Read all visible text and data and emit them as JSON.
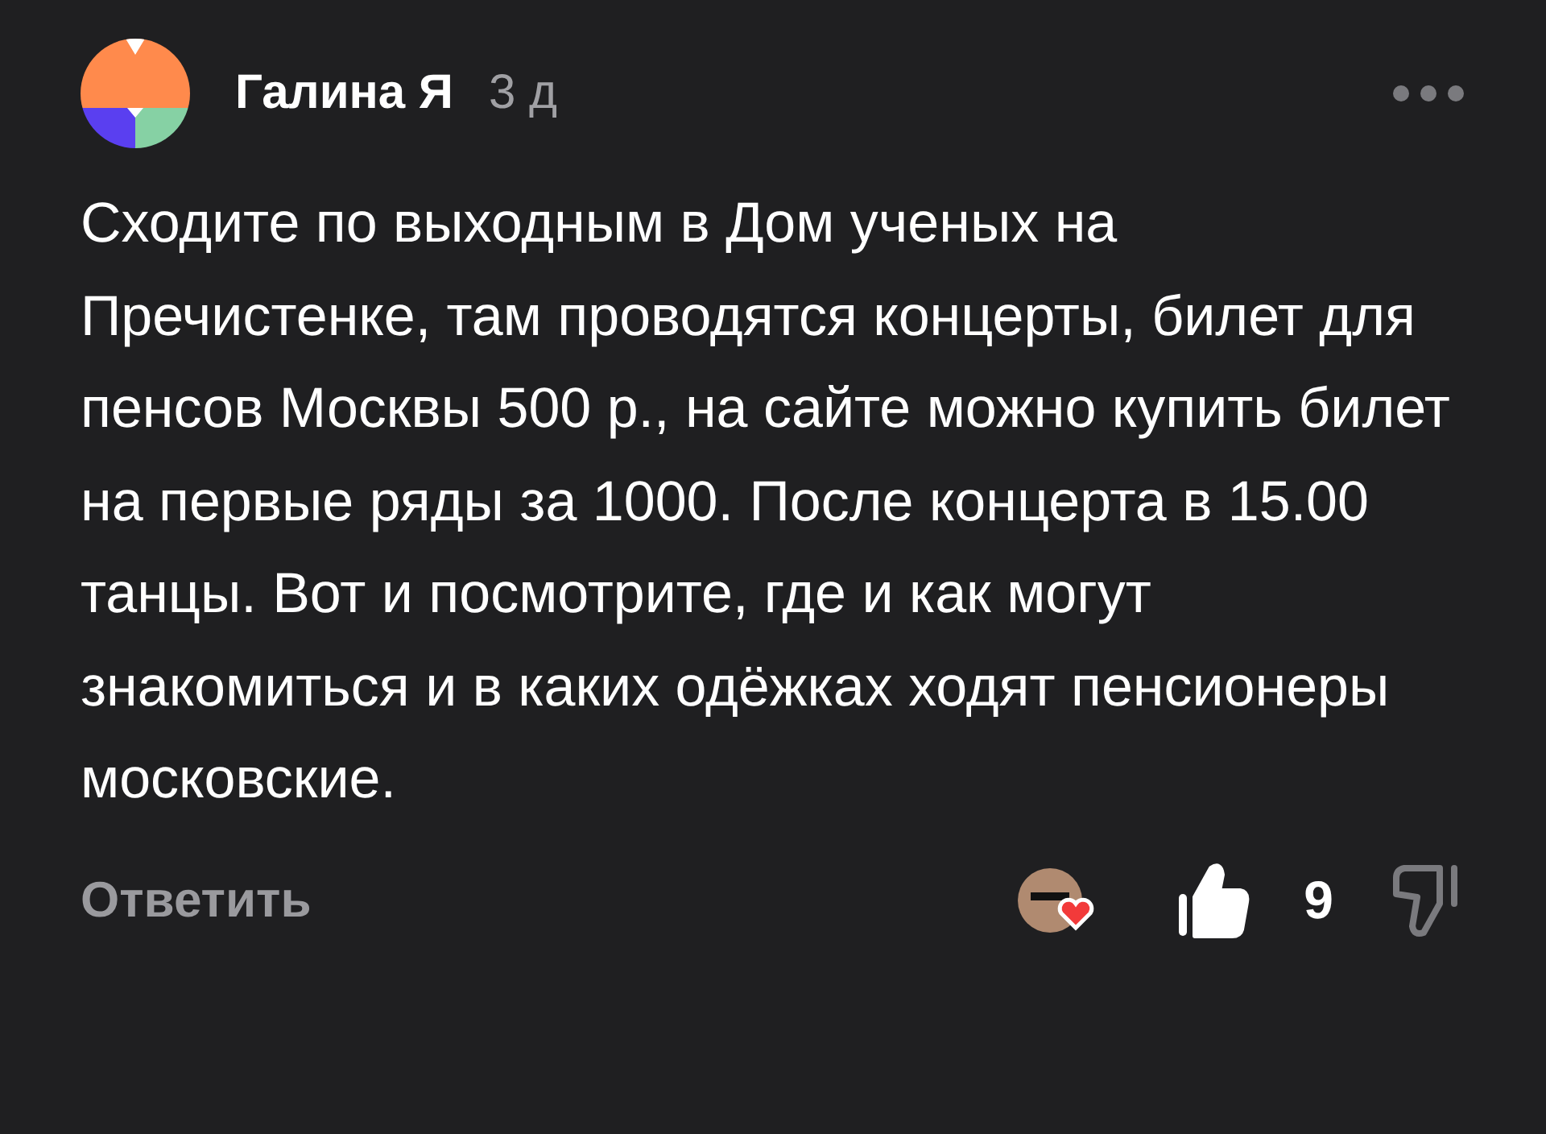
{
  "comment": {
    "author": "Галина Я",
    "time": "3 д",
    "text": "Сходите по выходным в Дом ученых на Пречистенке, там проводятся концерты, билет для пенсов Москвы 500 р., на сайте можно купить билет на первые ряды за 1000. После концерта в 15.00 танцы. Вот и посмотрите, где и как могут знакомиться и в каких одёжках ходят пенсионеры московские.",
    "reply": "Ответить",
    "author_liked": true,
    "liked": true,
    "likes": "9",
    "disliked": false
  }
}
